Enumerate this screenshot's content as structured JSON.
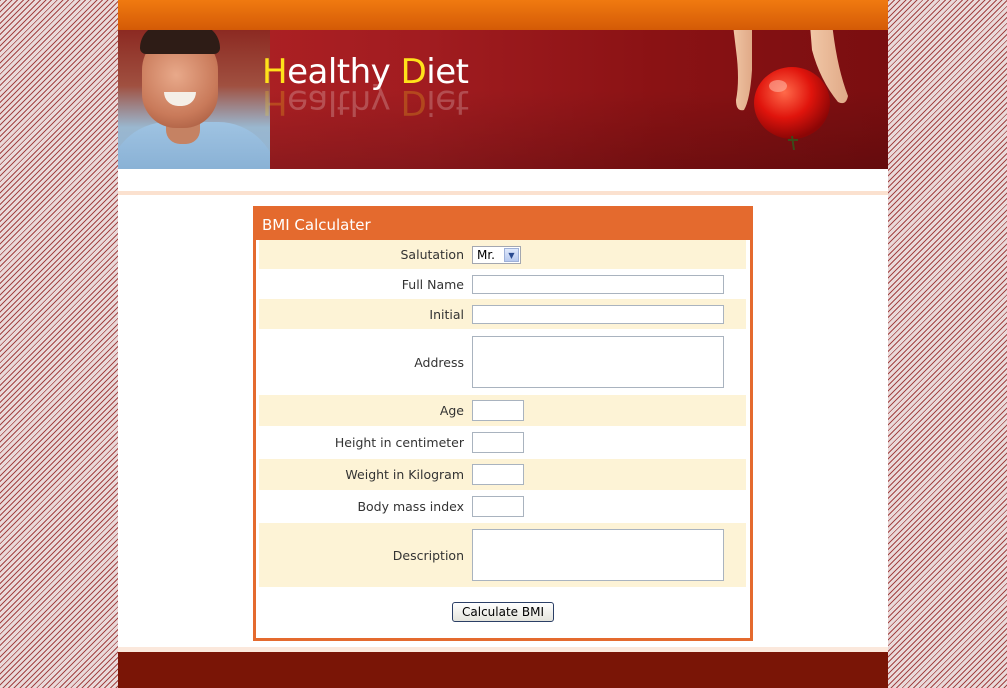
{
  "logo": {
    "first_cap": "H",
    "first_rest": "ealthy",
    "second_cap": "D",
    "second_rest": "iet"
  },
  "form": {
    "title": "BMI Calculater",
    "labels": {
      "salutation": "Salutation",
      "full_name": "Full Name",
      "initial": "Initial",
      "address": "Address",
      "age": "Age",
      "height": "Height in centimeter",
      "weight": "Weight in Kilogram",
      "bmi": "Body mass index",
      "description": "Description"
    },
    "salutation_value": "Mr.",
    "values": {
      "full_name": "",
      "initial": "",
      "address": "",
      "age": "",
      "height": "",
      "weight": "",
      "bmi": "",
      "description": ""
    },
    "submit_label": "Calculate BMI"
  },
  "icons": {
    "dropdown_arrow": "chevron-down-icon"
  },
  "colors": {
    "accent": "#e46a2e",
    "row_shade": "#fdf3d6",
    "banner": "#a11c20",
    "logo_capital": "#ffe21a",
    "footer": "#7a1506"
  }
}
